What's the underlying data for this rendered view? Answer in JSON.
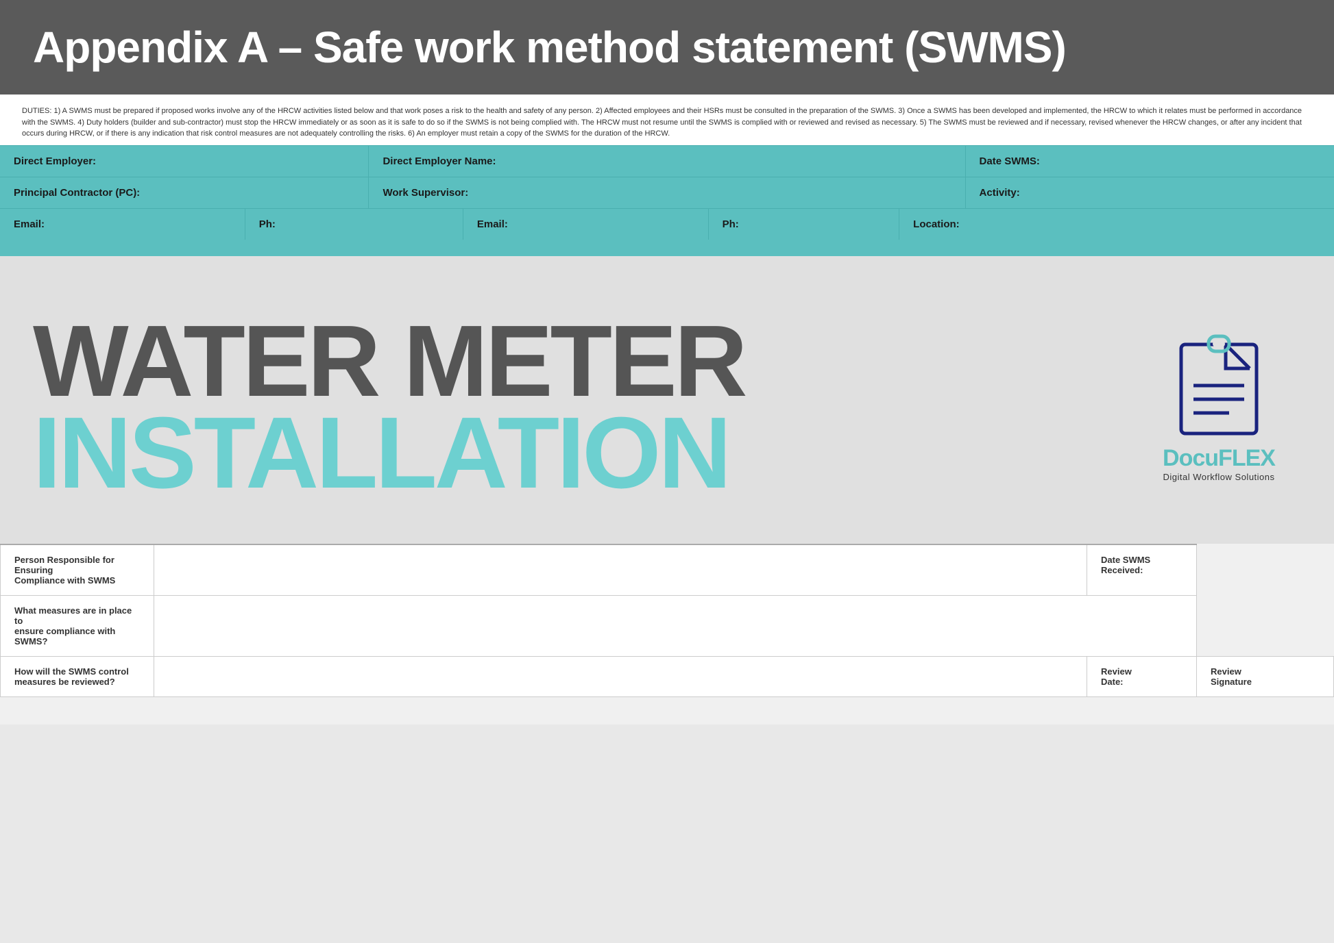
{
  "header": {
    "title": "Appendix A – Safe work method statement (SWMS)"
  },
  "duties": {
    "text": "DUTIES: 1) A SWMS must be prepared if proposed works involve any of the HRCW activities listed below and that work poses a risk to the health and safety of any person. 2) Affected employees and their HSRs must be consulted in the preparation of the SWMS. 3) Once a SWMS has been developed and implemented, the HRCW to which it relates must be performed in accordance with the SWMS. 4) Duty holders (builder and sub-contractor) must stop the HRCW immediately or as soon as it is safe to do so if the SWMS is not being complied with. The HRCW must not resume until the SWMS is complied with or reviewed and revised as necessary. 5) The SWMS must be reviewed and if necessary, revised whenever the HRCW changes, or after any incident that occurs during HRCW, or if there is any indication that risk control measures are not adequately controlling the risks. 6) An employer must retain a copy of the SWMS for the duration of the HRCW."
  },
  "form": {
    "row1": {
      "direct_employer_label": "Direct Employer:",
      "direct_employer_name_label": "Direct Employer Name:",
      "date_swms_label": "Date SWMS:"
    },
    "row2": {
      "principal_contractor_label": "Principal Contractor (PC):",
      "work_supervisor_label": "Work Supervisor:",
      "activity_label": "Activity:"
    },
    "row3": {
      "email1_label": "Email:",
      "ph1_label": "Ph:",
      "email2_label": "Email:",
      "ph2_label": "Ph:",
      "location_label": "Location:"
    }
  },
  "visual": {
    "line1": "WATER METER",
    "line2": "INSTALLATION",
    "brand_name_part1": "Docu",
    "brand_name_part2": "FLEX",
    "brand_tagline": "Digital Workflow Solutions"
  },
  "bottom_form": {
    "row1": {
      "label": "Person Responsible for Ensuring\nCompliance with SWMS",
      "value": "",
      "right_label": "Date SWMS\nReceived:"
    },
    "row2": {
      "label": "What measures are in place to\nensure compliance with SWMS?",
      "value": "",
      "colspan": true
    },
    "row3": {
      "label": "How will the SWMS control\nmeasures be reviewed?",
      "value": "",
      "right1_label": "Review\nDate:",
      "right2_label": "Review\nSignature"
    }
  }
}
